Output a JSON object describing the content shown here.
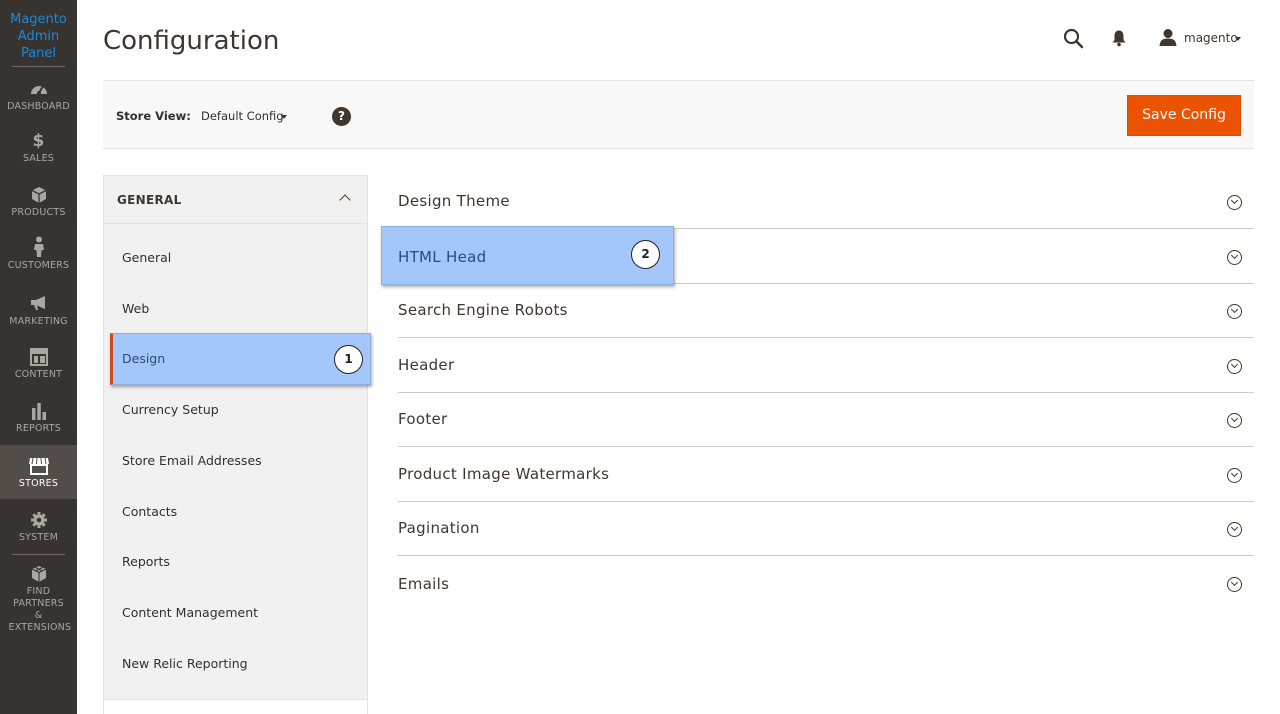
{
  "nav": {
    "logo": "Magento Admin Panel",
    "items": [
      {
        "label": "DASHBOARD",
        "icon": "dashboard-icon"
      },
      {
        "label": "SALES",
        "icon": "dollar-icon"
      },
      {
        "label": "PRODUCTS",
        "icon": "box-icon"
      },
      {
        "label": "CUSTOMERS",
        "icon": "person-icon"
      },
      {
        "label": "MARKETING",
        "icon": "megaphone-icon"
      },
      {
        "label": "CONTENT",
        "icon": "layout-icon"
      },
      {
        "label": "REPORTS",
        "icon": "bar-chart-icon"
      },
      {
        "label": "STORES",
        "icon": "storefront-icon"
      },
      {
        "label": "SYSTEM",
        "icon": "gear-icon"
      },
      {
        "label": "FIND PARTNERS & EXTENSIONS",
        "icon": "cubes-icon"
      }
    ],
    "active": "STORES"
  },
  "header": {
    "title": "Configuration",
    "user": "magento"
  },
  "store_bar": {
    "label": "Store View:",
    "value": "Default Config",
    "save_label": "Save Config",
    "help": "?"
  },
  "tabs": {
    "group": "GENERAL",
    "items": [
      "General",
      "Web",
      "Design",
      "Currency Setup",
      "Store Email Addresses",
      "Contacts",
      "Reports",
      "Content Management",
      "New Relic Reporting"
    ],
    "active": "Design"
  },
  "sections": [
    "Design Theme",
    "HTML Head",
    "Search Engine Robots",
    "Header",
    "Footer",
    "Product Image Watermarks",
    "Pagination",
    "Emails"
  ],
  "badges": {
    "one": "1",
    "two": "2"
  },
  "colors": {
    "nav_bg": "#373330",
    "accent": "#eb5202",
    "highlight": "#a4c7fb",
    "logo": "#1e8ad6"
  }
}
